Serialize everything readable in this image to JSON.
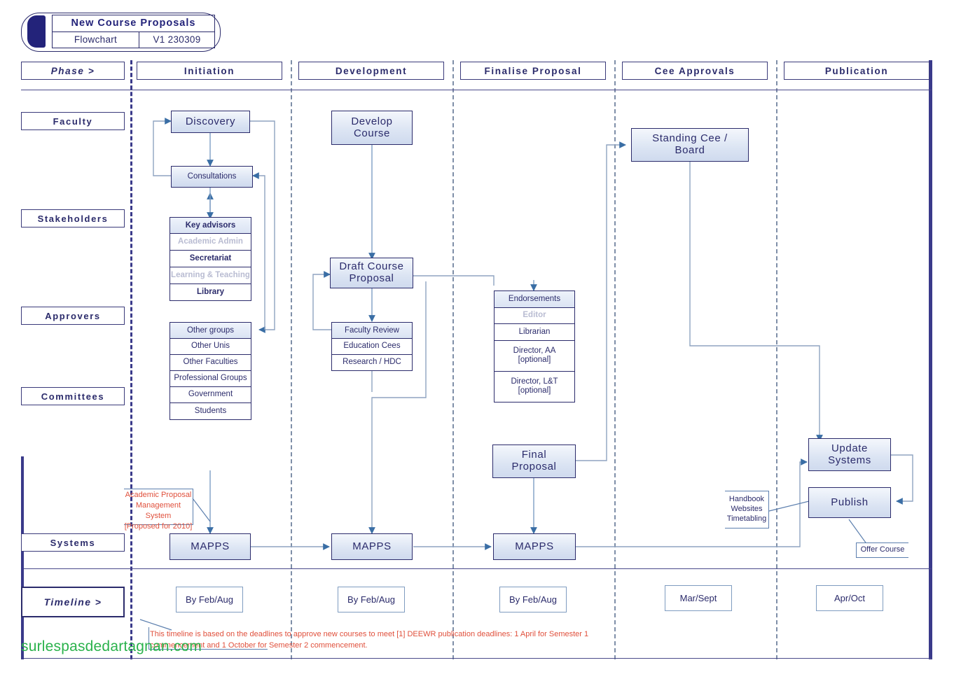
{
  "title_block": {
    "title": "New Course Proposals",
    "doc_type": "Flowchart",
    "version": "V1 230309"
  },
  "header": {
    "phase_label": "Phase >",
    "columns": [
      "Initiation",
      "Development",
      "Finalise Proposal",
      "Cee Approvals",
      "Publication"
    ]
  },
  "row_labels": [
    "Faculty",
    "Stakeholders",
    "Approvers",
    "Committees",
    "Systems"
  ],
  "timeline": {
    "label": "Timeline >",
    "values": [
      "By Feb/Aug",
      "By Feb/Aug",
      "By Feb/Aug",
      "Mar/Sept",
      "Apr/Oct"
    ]
  },
  "nodes": {
    "discovery": "Discovery",
    "consultations": "Consultations",
    "develop_course": "Develop\nCourse",
    "draft_course_proposal": "Draft Course\nProposal",
    "final_proposal": "Final\nProposal",
    "standing_cee_board": "Standing Cee  /\nBoard",
    "update_systems": "Update\nSystems",
    "publish": "Publish",
    "mapps_initiation": "MAPPS",
    "mapps_development": "MAPPS",
    "mapps_finalise": "MAPPS"
  },
  "key_advisors": {
    "header": "Key advisors",
    "items": [
      "Academic Admin",
      "Secretariat",
      "Learning & Teaching",
      "Library"
    ]
  },
  "other_groups": {
    "header": "Other groups",
    "items": [
      "Other Unis",
      "Other Faculties",
      "Professional Groups",
      "Government",
      "Students"
    ]
  },
  "faculty_review": {
    "header": "Faculty Review",
    "items": [
      "Education Cees",
      "Research / HDC"
    ]
  },
  "endorsements": {
    "header": "Endorsements",
    "items": [
      "Editor",
      "Librarian",
      "Director, AA\n[optional]",
      "Director, L&T\n[optional]"
    ]
  },
  "callouts": {
    "publish_targets": "Handbook\nWebsites\nTimetabling",
    "offer_course": "Offer Course",
    "mapps_note": "Academic Proposal\nManagement System\n[Proposed for 2010]"
  },
  "footnote": "This timeline is based on the deadlines to approve new courses to meet [1] DEEWR publication deadlines: 1 April for Semester 1 commencement and 1 October for Semester 2 commencement.",
  "watermark": "surlespasdedartagnan.com",
  "colors": {
    "navy": "#2b2b6b",
    "box_fill": "#dbe4f3",
    "connector": "#6b7fa0",
    "arrow": "#3a6ea5",
    "red": "#e0503c",
    "green": "#2bb24c"
  }
}
